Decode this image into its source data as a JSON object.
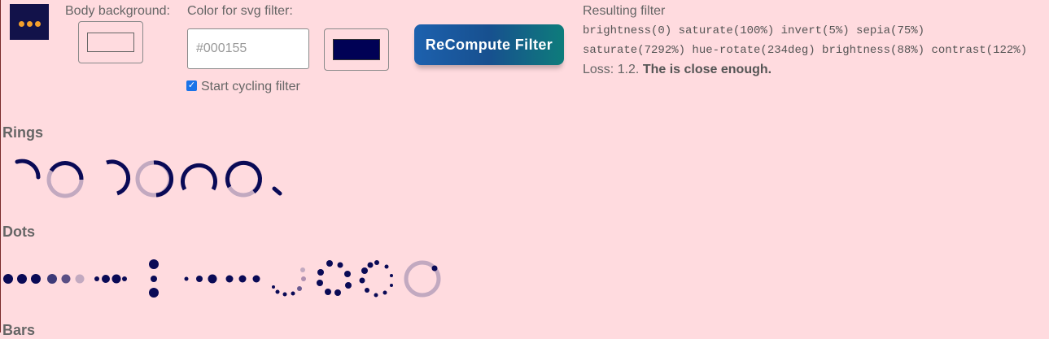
{
  "header": {
    "body_background_label": "Body background:",
    "svg_filter_label": "Color for svg filter:",
    "color_input_placeholder": "#000155",
    "color_input_value": "",
    "cycle_label": "Start cycling filter",
    "cycle_checked": true,
    "recompute_label": "ReCompute Filter",
    "body_background_color": "#ffdbdf",
    "filter_color": "#000155"
  },
  "result": {
    "title": "Resulting filter",
    "line1": "brightness(0) saturate(100%) invert(5%) sepia(75%)",
    "line2": "saturate(7292%) hue-rotate(234deg) brightness(88%) contrast(122%)",
    "loss_prefix": "Loss: 1.2.",
    "loss_verdict": "The is close enough."
  },
  "sections": {
    "rings": "Rings",
    "dots": "Dots",
    "bars": "Bars"
  },
  "colors": {
    "accent": "#0a0a56",
    "faded": "#c2a9c0",
    "page_bg": "#ffdbdf"
  }
}
